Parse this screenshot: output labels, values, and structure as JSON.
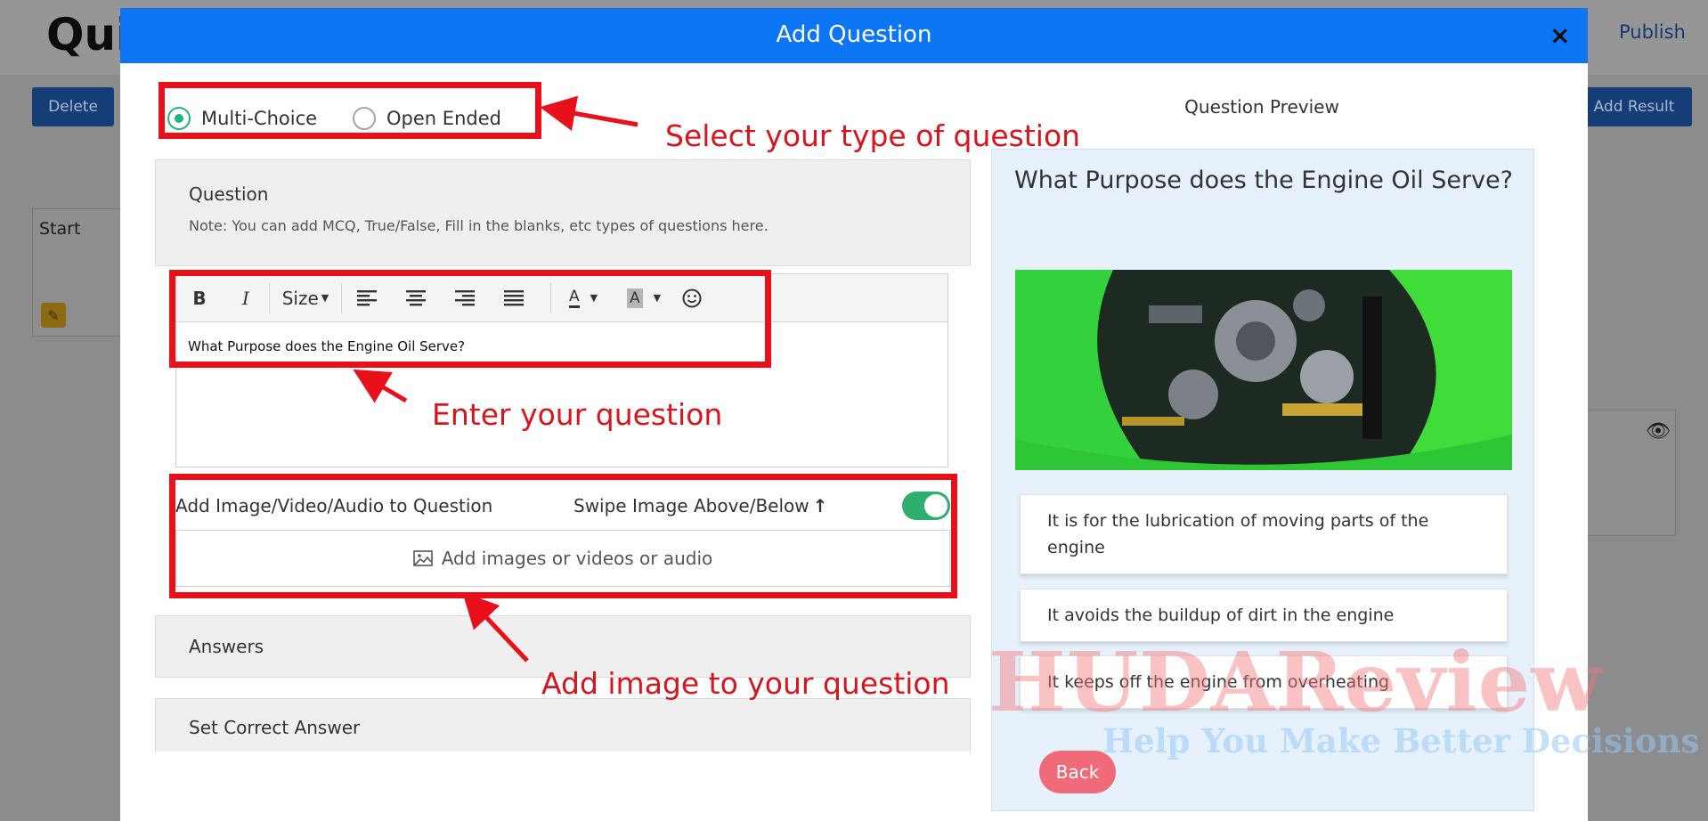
{
  "background": {
    "logo": "Qui",
    "publish": "Publish",
    "delete_button": "Delete",
    "add_result_button": "Add Result",
    "start_label": "Start"
  },
  "modal": {
    "title": "Add Question",
    "close": "×"
  },
  "question_type": {
    "options": [
      {
        "label": "Multi-Choice",
        "selected": true
      },
      {
        "label": "Open Ended",
        "selected": false
      }
    ]
  },
  "question_section": {
    "title": "Question",
    "note": "Note: You can add MCQ, True/False, Fill in the blanks, etc types of questions here."
  },
  "editor": {
    "toolbar": {
      "bold": "B",
      "italic": "I",
      "size": "Size",
      "font_color": "A",
      "highlight": "A"
    },
    "content": "What Purpose does the Engine Oil Serve?"
  },
  "media": {
    "label": "Add Image/Video/Audio to Question",
    "swipe_label": "Swipe Image Above/Below",
    "swipe_enabled": true,
    "upload_label": "Add images or videos or audio"
  },
  "sections": {
    "answers": "Answers",
    "correct_answer": "Set Correct Answer"
  },
  "annotations": {
    "type": "Select your type of question",
    "question": "Enter your question",
    "image": "Add image to your question"
  },
  "preview": {
    "title": "Question Preview",
    "question": "What Purpose does the Engine Oil Serve?",
    "answers": [
      "It is for the lubrication of moving parts of the engine",
      "It avoids the buildup of dirt in the engine",
      "It keeps off the engine from overheating"
    ],
    "back_button": "Back"
  },
  "watermark": {
    "brand": "HUDAReview",
    "tagline": "Help You Make Better Decisions"
  },
  "colors": {
    "modal_header": "#0d76f4",
    "annotation_red": "#e8101a",
    "toggle_green": "#2fae6f",
    "radio_green": "#24b37c",
    "back_button": "#f06a7a"
  }
}
